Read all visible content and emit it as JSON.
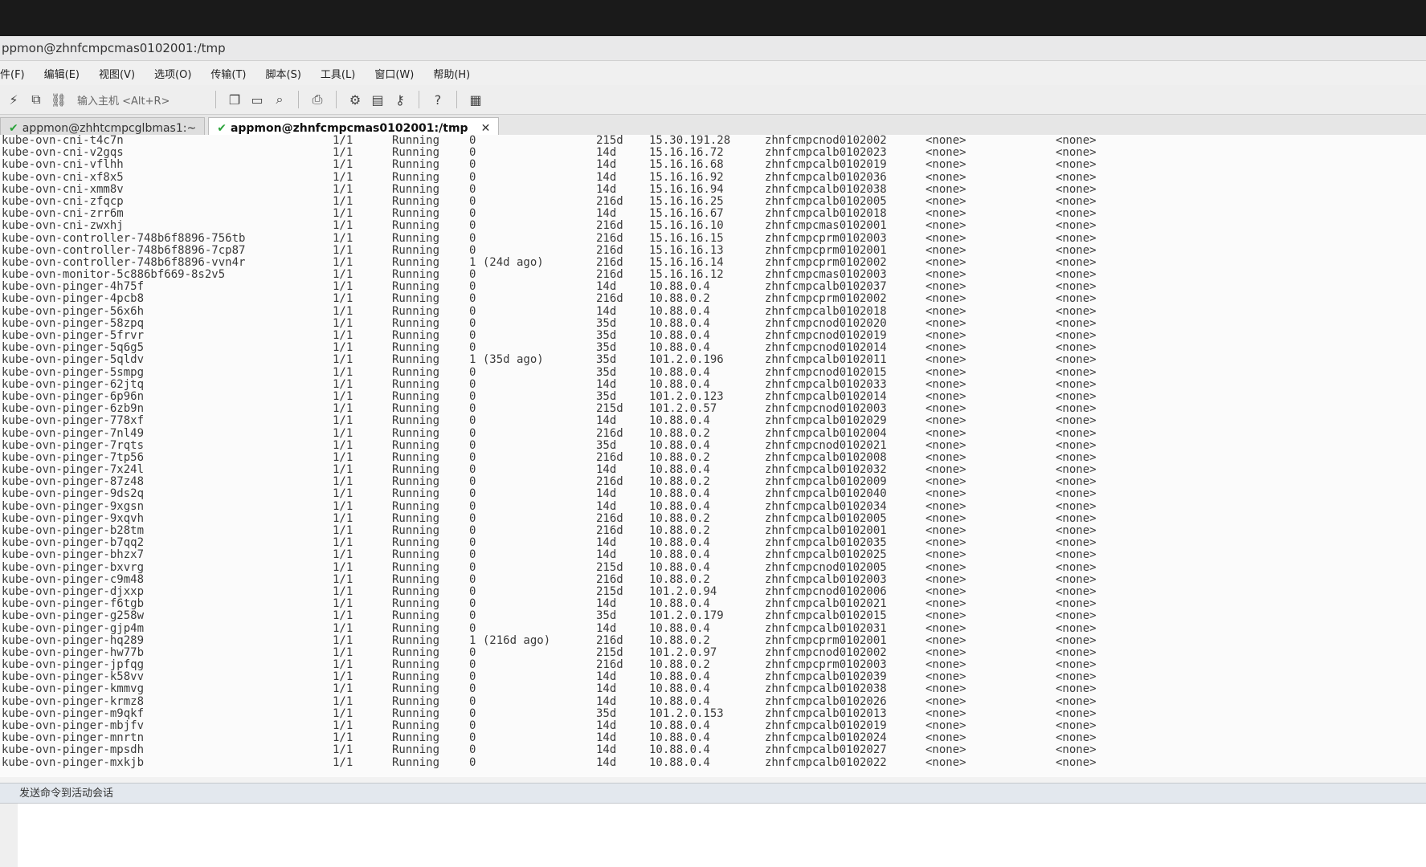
{
  "window": {
    "title": "ppmon@zhnfcmpcmas0102001:/tmp"
  },
  "menu": [
    "件(F)",
    "编辑(E)",
    "视图(V)",
    "选项(O)",
    "传输(T)",
    "脚本(S)",
    "工具(L)",
    "窗口(W)",
    "帮助(H)"
  ],
  "toolbar": {
    "quick_connect_label": "输入主机 <Alt+R>",
    "icons": [
      "lightning-icon",
      "reconnect-icon",
      "link-icon",
      "copy-icon",
      "paste-icon",
      "find-icon",
      "print-icon",
      "settings-icon",
      "sftp-icon",
      "key-icon",
      "help-icon",
      "map-icon"
    ]
  },
  "tabs": [
    {
      "label": "appmon@zhhtcmpcglbmas1:~",
      "active": false
    },
    {
      "label": "appmon@zhnfcmpcmas0102001:/tmp",
      "active": true
    }
  ],
  "rows": [
    {
      "name": "kube-ovn-cni-t4c7n",
      "ready": "1/1",
      "status": "Running",
      "restarts": "0",
      "age": "215d",
      "ip": "15.30.191.28",
      "node": "zhnfcmpcnod0102002",
      "nominated": "<none>",
      "gates": "<none>"
    },
    {
      "name": "kube-ovn-cni-v2gqs",
      "ready": "1/1",
      "status": "Running",
      "restarts": "0",
      "age": "14d",
      "ip": "15.16.16.72",
      "node": "zhnfcmpcalb0102023",
      "nominated": "<none>",
      "gates": "<none>"
    },
    {
      "name": "kube-ovn-cni-vflhh",
      "ready": "1/1",
      "status": "Running",
      "restarts": "0",
      "age": "14d",
      "ip": "15.16.16.68",
      "node": "zhnfcmpcalb0102019",
      "nominated": "<none>",
      "gates": "<none>"
    },
    {
      "name": "kube-ovn-cni-xf8x5",
      "ready": "1/1",
      "status": "Running",
      "restarts": "0",
      "age": "14d",
      "ip": "15.16.16.92",
      "node": "zhnfcmpcalb0102036",
      "nominated": "<none>",
      "gates": "<none>"
    },
    {
      "name": "kube-ovn-cni-xmm8v",
      "ready": "1/1",
      "status": "Running",
      "restarts": "0",
      "age": "14d",
      "ip": "15.16.16.94",
      "node": "zhnfcmpcalb0102038",
      "nominated": "<none>",
      "gates": "<none>"
    },
    {
      "name": "kube-ovn-cni-zfqcp",
      "ready": "1/1",
      "status": "Running",
      "restarts": "0",
      "age": "216d",
      "ip": "15.16.16.25",
      "node": "zhnfcmpcalb0102005",
      "nominated": "<none>",
      "gates": "<none>"
    },
    {
      "name": "kube-ovn-cni-zrr6m",
      "ready": "1/1",
      "status": "Running",
      "restarts": "0",
      "age": "14d",
      "ip": "15.16.16.67",
      "node": "zhnfcmpcalb0102018",
      "nominated": "<none>",
      "gates": "<none>"
    },
    {
      "name": "kube-ovn-cni-zwxhj",
      "ready": "1/1",
      "status": "Running",
      "restarts": "0",
      "age": "216d",
      "ip": "15.16.16.10",
      "node": "zhnfcmpcmas0102001",
      "nominated": "<none>",
      "gates": "<none>"
    },
    {
      "name": "kube-ovn-controller-748b6f8896-756tb",
      "ready": "1/1",
      "status": "Running",
      "restarts": "0",
      "age": "216d",
      "ip": "15.16.16.15",
      "node": "zhnfcmpcprm0102003",
      "nominated": "<none>",
      "gates": "<none>"
    },
    {
      "name": "kube-ovn-controller-748b6f8896-7cp87",
      "ready": "1/1",
      "status": "Running",
      "restarts": "0",
      "age": "216d",
      "ip": "15.16.16.13",
      "node": "zhnfcmpcprm0102001",
      "nominated": "<none>",
      "gates": "<none>"
    },
    {
      "name": "kube-ovn-controller-748b6f8896-vvn4r",
      "ready": "1/1",
      "status": "Running",
      "restarts": "1 (24d ago)",
      "age": "216d",
      "ip": "15.16.16.14",
      "node": "zhnfcmpcprm0102002",
      "nominated": "<none>",
      "gates": "<none>"
    },
    {
      "name": "kube-ovn-monitor-5c886bf669-8s2v5",
      "ready": "1/1",
      "status": "Running",
      "restarts": "0",
      "age": "216d",
      "ip": "15.16.16.12",
      "node": "zhnfcmpcmas0102003",
      "nominated": "<none>",
      "gates": "<none>"
    },
    {
      "name": "kube-ovn-pinger-4h75f",
      "ready": "1/1",
      "status": "Running",
      "restarts": "0",
      "age": "14d",
      "ip": "10.88.0.4",
      "node": "zhnfcmpcalb0102037",
      "nominated": "<none>",
      "gates": "<none>"
    },
    {
      "name": "kube-ovn-pinger-4pcb8",
      "ready": "1/1",
      "status": "Running",
      "restarts": "0",
      "age": "216d",
      "ip": "10.88.0.2",
      "node": "zhnfcmpcprm0102002",
      "nominated": "<none>",
      "gates": "<none>"
    },
    {
      "name": "kube-ovn-pinger-56x6h",
      "ready": "1/1",
      "status": "Running",
      "restarts": "0",
      "age": "14d",
      "ip": "10.88.0.4",
      "node": "zhnfcmpcalb0102018",
      "nominated": "<none>",
      "gates": "<none>"
    },
    {
      "name": "kube-ovn-pinger-58zpq",
      "ready": "1/1",
      "status": "Running",
      "restarts": "0",
      "age": "35d",
      "ip": "10.88.0.4",
      "node": "zhnfcmpcnod0102020",
      "nominated": "<none>",
      "gates": "<none>"
    },
    {
      "name": "kube-ovn-pinger-5frvr",
      "ready": "1/1",
      "status": "Running",
      "restarts": "0",
      "age": "35d",
      "ip": "10.88.0.4",
      "node": "zhnfcmpcnod0102019",
      "nominated": "<none>",
      "gates": "<none>"
    },
    {
      "name": "kube-ovn-pinger-5q6g5",
      "ready": "1/1",
      "status": "Running",
      "restarts": "0",
      "age": "35d",
      "ip": "10.88.0.4",
      "node": "zhnfcmpcnod0102014",
      "nominated": "<none>",
      "gates": "<none>"
    },
    {
      "name": "kube-ovn-pinger-5qldv",
      "ready": "1/1",
      "status": "Running",
      "restarts": "1 (35d ago)",
      "age": "35d",
      "ip": "101.2.0.196",
      "node": "zhnfcmpcalb0102011",
      "nominated": "<none>",
      "gates": "<none>"
    },
    {
      "name": "kube-ovn-pinger-5smpg",
      "ready": "1/1",
      "status": "Running",
      "restarts": "0",
      "age": "35d",
      "ip": "10.88.0.4",
      "node": "zhnfcmpcnod0102015",
      "nominated": "<none>",
      "gates": "<none>"
    },
    {
      "name": "kube-ovn-pinger-62jtq",
      "ready": "1/1",
      "status": "Running",
      "restarts": "0",
      "age": "14d",
      "ip": "10.88.0.4",
      "node": "zhnfcmpcalb0102033",
      "nominated": "<none>",
      "gates": "<none>"
    },
    {
      "name": "kube-ovn-pinger-6p96n",
      "ready": "1/1",
      "status": "Running",
      "restarts": "0",
      "age": "35d",
      "ip": "101.2.0.123",
      "node": "zhnfcmpcalb0102014",
      "nominated": "<none>",
      "gates": "<none>"
    },
    {
      "name": "kube-ovn-pinger-6zb9n",
      "ready": "1/1",
      "status": "Running",
      "restarts": "0",
      "age": "215d",
      "ip": "101.2.0.57",
      "node": "zhnfcmpcnod0102003",
      "nominated": "<none>",
      "gates": "<none>"
    },
    {
      "name": "kube-ovn-pinger-778xf",
      "ready": "1/1",
      "status": "Running",
      "restarts": "0",
      "age": "14d",
      "ip": "10.88.0.4",
      "node": "zhnfcmpcalb0102029",
      "nominated": "<none>",
      "gates": "<none>"
    },
    {
      "name": "kube-ovn-pinger-7nl49",
      "ready": "1/1",
      "status": "Running",
      "restarts": "0",
      "age": "216d",
      "ip": "10.88.0.2",
      "node": "zhnfcmpcalb0102004",
      "nominated": "<none>",
      "gates": "<none>"
    },
    {
      "name": "kube-ovn-pinger-7rqts",
      "ready": "1/1",
      "status": "Running",
      "restarts": "0",
      "age": "35d",
      "ip": "10.88.0.4",
      "node": "zhnfcmpcnod0102021",
      "nominated": "<none>",
      "gates": "<none>"
    },
    {
      "name": "kube-ovn-pinger-7tp56",
      "ready": "1/1",
      "status": "Running",
      "restarts": "0",
      "age": "216d",
      "ip": "10.88.0.2",
      "node": "zhnfcmpcalb0102008",
      "nominated": "<none>",
      "gates": "<none>"
    },
    {
      "name": "kube-ovn-pinger-7x24l",
      "ready": "1/1",
      "status": "Running",
      "restarts": "0",
      "age": "14d",
      "ip": "10.88.0.4",
      "node": "zhnfcmpcalb0102032",
      "nominated": "<none>",
      "gates": "<none>"
    },
    {
      "name": "kube-ovn-pinger-87z48",
      "ready": "1/1",
      "status": "Running",
      "restarts": "0",
      "age": "216d",
      "ip": "10.88.0.2",
      "node": "zhnfcmpcalb0102009",
      "nominated": "<none>",
      "gates": "<none>"
    },
    {
      "name": "kube-ovn-pinger-9ds2q",
      "ready": "1/1",
      "status": "Running",
      "restarts": "0",
      "age": "14d",
      "ip": "10.88.0.4",
      "node": "zhnfcmpcalb0102040",
      "nominated": "<none>",
      "gates": "<none>"
    },
    {
      "name": "kube-ovn-pinger-9xgsn",
      "ready": "1/1",
      "status": "Running",
      "restarts": "0",
      "age": "14d",
      "ip": "10.88.0.4",
      "node": "zhnfcmpcalb0102034",
      "nominated": "<none>",
      "gates": "<none>"
    },
    {
      "name": "kube-ovn-pinger-9xqvh",
      "ready": "1/1",
      "status": "Running",
      "restarts": "0",
      "age": "216d",
      "ip": "10.88.0.2",
      "node": "zhnfcmpcalb0102005",
      "nominated": "<none>",
      "gates": "<none>"
    },
    {
      "name": "kube-ovn-pinger-b28tm",
      "ready": "1/1",
      "status": "Running",
      "restarts": "0",
      "age": "216d",
      "ip": "10.88.0.2",
      "node": "zhnfcmpcalb0102001",
      "nominated": "<none>",
      "gates": "<none>"
    },
    {
      "name": "kube-ovn-pinger-b7qq2",
      "ready": "1/1",
      "status": "Running",
      "restarts": "0",
      "age": "14d",
      "ip": "10.88.0.4",
      "node": "zhnfcmpcalb0102035",
      "nominated": "<none>",
      "gates": "<none>"
    },
    {
      "name": "kube-ovn-pinger-bhzx7",
      "ready": "1/1",
      "status": "Running",
      "restarts": "0",
      "age": "14d",
      "ip": "10.88.0.4",
      "node": "zhnfcmpcalb0102025",
      "nominated": "<none>",
      "gates": "<none>"
    },
    {
      "name": "kube-ovn-pinger-bxvrg",
      "ready": "1/1",
      "status": "Running",
      "restarts": "0",
      "age": "215d",
      "ip": "10.88.0.4",
      "node": "zhnfcmpcnod0102005",
      "nominated": "<none>",
      "gates": "<none>"
    },
    {
      "name": "kube-ovn-pinger-c9m48",
      "ready": "1/1",
      "status": "Running",
      "restarts": "0",
      "age": "216d",
      "ip": "10.88.0.2",
      "node": "zhnfcmpcalb0102003",
      "nominated": "<none>",
      "gates": "<none>"
    },
    {
      "name": "kube-ovn-pinger-djxxp",
      "ready": "1/1",
      "status": "Running",
      "restarts": "0",
      "age": "215d",
      "ip": "101.2.0.94",
      "node": "zhnfcmpcnod0102006",
      "nominated": "<none>",
      "gates": "<none>"
    },
    {
      "name": "kube-ovn-pinger-f6tgb",
      "ready": "1/1",
      "status": "Running",
      "restarts": "0",
      "age": "14d",
      "ip": "10.88.0.4",
      "node": "zhnfcmpcalb0102021",
      "nominated": "<none>",
      "gates": "<none>"
    },
    {
      "name": "kube-ovn-pinger-g258w",
      "ready": "1/1",
      "status": "Running",
      "restarts": "0",
      "age": "35d",
      "ip": "101.2.0.179",
      "node": "zhnfcmpcalb0102015",
      "nominated": "<none>",
      "gates": "<none>"
    },
    {
      "name": "kube-ovn-pinger-gjp4m",
      "ready": "1/1",
      "status": "Running",
      "restarts": "0",
      "age": "14d",
      "ip": "10.88.0.4",
      "node": "zhnfcmpcalb0102031",
      "nominated": "<none>",
      "gates": "<none>"
    },
    {
      "name": "kube-ovn-pinger-hq289",
      "ready": "1/1",
      "status": "Running",
      "restarts": "1 (216d ago)",
      "age": "216d",
      "ip": "10.88.0.2",
      "node": "zhnfcmpcprm0102001",
      "nominated": "<none>",
      "gates": "<none>"
    },
    {
      "name": "kube-ovn-pinger-hw77b",
      "ready": "1/1",
      "status": "Running",
      "restarts": "0",
      "age": "215d",
      "ip": "101.2.0.97",
      "node": "zhnfcmpcnod0102002",
      "nominated": "<none>",
      "gates": "<none>"
    },
    {
      "name": "kube-ovn-pinger-jpfqg",
      "ready": "1/1",
      "status": "Running",
      "restarts": "0",
      "age": "216d",
      "ip": "10.88.0.2",
      "node": "zhnfcmpcprm0102003",
      "nominated": "<none>",
      "gates": "<none>"
    },
    {
      "name": "kube-ovn-pinger-k58vv",
      "ready": "1/1",
      "status": "Running",
      "restarts": "0",
      "age": "14d",
      "ip": "10.88.0.4",
      "node": "zhnfcmpcalb0102039",
      "nominated": "<none>",
      "gates": "<none>"
    },
    {
      "name": "kube-ovn-pinger-kmmvg",
      "ready": "1/1",
      "status": "Running",
      "restarts": "0",
      "age": "14d",
      "ip": "10.88.0.4",
      "node": "zhnfcmpcalb0102038",
      "nominated": "<none>",
      "gates": "<none>"
    },
    {
      "name": "kube-ovn-pinger-krmz8",
      "ready": "1/1",
      "status": "Running",
      "restarts": "0",
      "age": "14d",
      "ip": "10.88.0.4",
      "node": "zhnfcmpcalb0102026",
      "nominated": "<none>",
      "gates": "<none>"
    },
    {
      "name": "kube-ovn-pinger-m9qkf",
      "ready": "1/1",
      "status": "Running",
      "restarts": "0",
      "age": "35d",
      "ip": "101.2.0.153",
      "node": "zhnfcmpcalb0102013",
      "nominated": "<none>",
      "gates": "<none>"
    },
    {
      "name": "kube-ovn-pinger-mbjfv",
      "ready": "1/1",
      "status": "Running",
      "restarts": "0",
      "age": "14d",
      "ip": "10.88.0.4",
      "node": "zhnfcmpcalb0102019",
      "nominated": "<none>",
      "gates": "<none>"
    },
    {
      "name": "kube-ovn-pinger-mnrtn",
      "ready": "1/1",
      "status": "Running",
      "restarts": "0",
      "age": "14d",
      "ip": "10.88.0.4",
      "node": "zhnfcmpcalb0102024",
      "nominated": "<none>",
      "gates": "<none>"
    },
    {
      "name": "kube-ovn-pinger-mpsdh",
      "ready": "1/1",
      "status": "Running",
      "restarts": "0",
      "age": "14d",
      "ip": "10.88.0.4",
      "node": "zhnfcmpcalb0102027",
      "nominated": "<none>",
      "gates": "<none>"
    },
    {
      "name": "kube-ovn-pinger-mxkjb",
      "ready": "1/1",
      "status": "Running",
      "restarts": "0",
      "age": "14d",
      "ip": "10.88.0.4",
      "node": "zhnfcmpcalb0102022",
      "nominated": "<none>",
      "gates": "<none>"
    }
  ],
  "command_bar": {
    "label": "发送命令到活动会话"
  }
}
